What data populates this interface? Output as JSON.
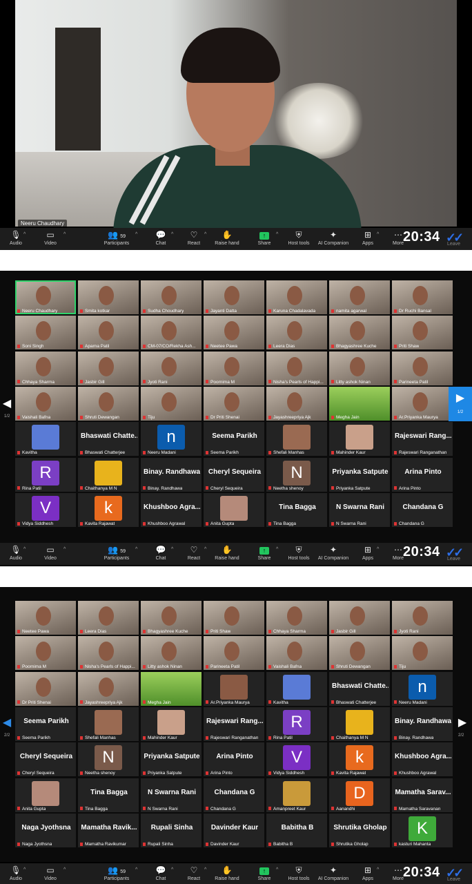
{
  "speaker": {
    "name": "Neeru Chaudhary"
  },
  "toolbar": {
    "audio": "Audio",
    "video": "Video",
    "participants": "Participants",
    "participants_count": "59",
    "chat": "Chat",
    "react": "React",
    "raise_hand": "Raise hand",
    "share": "Share",
    "host_tools": "Host tools",
    "ai_companion": "AI Companion",
    "apps": "Apps",
    "more": "More",
    "leave": "Leave",
    "clock": "20:34"
  },
  "page1": {
    "page_indicator_left": "1/2",
    "page_indicator_right": "1/2",
    "tiles": [
      {
        "name": "Neeru Chaudhary",
        "type": "cam",
        "active": true
      },
      {
        "name": "Smita kotkar",
        "type": "cam"
      },
      {
        "name": "Sudha Choudhary",
        "type": "cam"
      },
      {
        "name": "Jayanti Datta",
        "type": "cam"
      },
      {
        "name": "Karuna Chadalavada",
        "type": "cam"
      },
      {
        "name": "namita agarwal",
        "type": "cam"
      },
      {
        "name": "Dr Ruchi Bansal",
        "type": "cam"
      },
      {
        "name": "Soni Singh",
        "type": "cam"
      },
      {
        "name": "Aparna Patil",
        "type": "cam"
      },
      {
        "name": "CM-07/CO/Rekha Ash...",
        "type": "cam"
      },
      {
        "name": "Neetee Pawa",
        "type": "cam"
      },
      {
        "name": "Leera Dias",
        "type": "cam"
      },
      {
        "name": "Bhagyashree Kuche",
        "type": "cam"
      },
      {
        "name": "Priti Shaw",
        "type": "cam"
      },
      {
        "name": "Chhaya Sharma",
        "type": "cam"
      },
      {
        "name": "Jasbir Gill",
        "type": "cam"
      },
      {
        "name": "Jyoti Rani",
        "type": "cam"
      },
      {
        "name": "Poornima M",
        "type": "cam"
      },
      {
        "name": "Nisha's Pearls of Happi...",
        "type": "cam"
      },
      {
        "name": "Litty ashok Ninan",
        "type": "cam"
      },
      {
        "name": "Parineeta Patil",
        "type": "cam"
      },
      {
        "name": "Vaishali Bafna",
        "type": "cam"
      },
      {
        "name": "Shruti Dewangan",
        "type": "cam"
      },
      {
        "name": "Tiju",
        "type": "cam"
      },
      {
        "name": "Dr Priti Shenai",
        "type": "cam"
      },
      {
        "name": "Jayashreepriya Ajk",
        "type": "cam"
      },
      {
        "name": "Megha Jain",
        "type": "grass"
      },
      {
        "name": "Ar.Priyanka Maurya",
        "type": "cam"
      },
      {
        "name": "Kavitha",
        "type": "photo",
        "color": "#5a7bd6"
      },
      {
        "name": "Bhaswati Chatterjee",
        "type": "text",
        "big": "Bhaswati Chatte..."
      },
      {
        "name": "Neeru Madani",
        "type": "avatar",
        "letter": "n",
        "color": "#0b5cad"
      },
      {
        "name": "Seema Parikh",
        "type": "text",
        "big": "Seema Parikh"
      },
      {
        "name": "Shefali Manhas",
        "type": "photo",
        "color": "#9a6a52"
      },
      {
        "name": "Mahinder Kaur",
        "type": "photo",
        "color": "#c9a08a"
      },
      {
        "name": "Rajeswari Ranganathan",
        "type": "text",
        "big": "Rajeswari Rang..."
      },
      {
        "name": "Rina Patil",
        "type": "avatar",
        "letter": "R",
        "color": "#7b3fc4"
      },
      {
        "name": "Chaithanya M N",
        "type": "photo",
        "color": "#e8b31c"
      },
      {
        "name": "Binay. Randhawa",
        "type": "text",
        "big": "Binay. Randhawa"
      },
      {
        "name": "Cheryl Sequeira",
        "type": "text",
        "big": "Cheryl Sequeira"
      },
      {
        "name": "Neetha shenoy",
        "type": "avatar",
        "letter": "N",
        "color": "#7a5a4a"
      },
      {
        "name": "Priyanka Satpute",
        "type": "text",
        "big": "Priyanka Satpute"
      },
      {
        "name": "Arina Pinto",
        "type": "text",
        "big": "Arina Pinto"
      },
      {
        "name": "Vidya Siddhesh",
        "type": "avatar",
        "letter": "V",
        "color": "#7b2fc4"
      },
      {
        "name": "Kavita Rajawat",
        "type": "avatar",
        "letter": "k",
        "color": "#e86a1e"
      },
      {
        "name": "Khushboo Agrawal",
        "type": "text",
        "big": "Khushboo Agra..."
      },
      {
        "name": "Anita Gupta",
        "type": "photo",
        "color": "#b58a7a"
      },
      {
        "name": "Tina Bagga",
        "type": "text",
        "big": "Tina Bagga"
      },
      {
        "name": "N Swarna Rani",
        "type": "text",
        "big": "N Swarna Rani"
      },
      {
        "name": "Chandana G",
        "type": "text",
        "big": "Chandana G"
      }
    ]
  },
  "page2": {
    "page_indicator_left": "2/2",
    "page_indicator_right": "2/2",
    "tiles": [
      {
        "name": "Neetee Pawa",
        "type": "cam"
      },
      {
        "name": "Leera Dias",
        "type": "cam"
      },
      {
        "name": "Bhagyashree Kuche",
        "type": "cam"
      },
      {
        "name": "Priti Shaw",
        "type": "cam"
      },
      {
        "name": "Chhaya Sharma",
        "type": "cam"
      },
      {
        "name": "Jasbir Gill",
        "type": "cam"
      },
      {
        "name": "Jyoti Rani",
        "type": "cam"
      },
      {
        "name": "Poornima M",
        "type": "cam"
      },
      {
        "name": "Nisha's Pearls of Happi...",
        "type": "cam"
      },
      {
        "name": "Litty ashok Ninan",
        "type": "cam"
      },
      {
        "name": "Parineeta Patil",
        "type": "cam"
      },
      {
        "name": "Vaishali Bafna",
        "type": "cam"
      },
      {
        "name": "Shruti Dewangan",
        "type": "cam"
      },
      {
        "name": "Tiju",
        "type": "cam"
      },
      {
        "name": "Dr Priti Shenai",
        "type": "cam"
      },
      {
        "name": "Jayashreepriya Ajk",
        "type": "cam"
      },
      {
        "name": "Megha Jain",
        "type": "grass"
      },
      {
        "name": "Ar.Priyanka Maurya",
        "type": "photo",
        "color": "#8a5a44"
      },
      {
        "name": "Kavitha",
        "type": "photo",
        "color": "#5a7bd6"
      },
      {
        "name": "Bhaswati Chatterjee",
        "type": "text",
        "big": "Bhaswati Chatte..."
      },
      {
        "name": "Neeru Madani",
        "type": "avatar",
        "letter": "n",
        "color": "#0b5cad"
      },
      {
        "name": "Seema Parikh",
        "type": "text",
        "big": "Seema Parikh"
      },
      {
        "name": "Shefali Manhas",
        "type": "photo",
        "color": "#9a6a52"
      },
      {
        "name": "Mahinder Kaur",
        "type": "photo",
        "color": "#c9a08a"
      },
      {
        "name": "Rajeswari Ranganathan",
        "type": "text",
        "big": "Rajeswari Rang..."
      },
      {
        "name": "Rina Patil",
        "type": "avatar",
        "letter": "R",
        "color": "#7b3fc4"
      },
      {
        "name": "Chaithanya M N",
        "type": "photo",
        "color": "#e8b31c"
      },
      {
        "name": "Binay. Randhawa",
        "type": "text",
        "big": "Binay. Randhawa"
      },
      {
        "name": "Cheryl Sequeira",
        "type": "text",
        "big": "Cheryl Sequeira"
      },
      {
        "name": "Neetha shenoy",
        "type": "avatar",
        "letter": "N",
        "color": "#7a5a4a"
      },
      {
        "name": "Priyanka Satpute",
        "type": "text",
        "big": "Priyanka Satpute"
      },
      {
        "name": "Arina Pinto",
        "type": "text",
        "big": "Arina Pinto"
      },
      {
        "name": "Vidya Siddhesh",
        "type": "avatar",
        "letter": "V",
        "color": "#7b2fc4"
      },
      {
        "name": "Kavita Rajawat",
        "type": "avatar",
        "letter": "k",
        "color": "#e86a1e"
      },
      {
        "name": "Khushboo Agrawal",
        "type": "text",
        "big": "Khushboo Agra..."
      },
      {
        "name": "Anita Gupta",
        "type": "photo",
        "color": "#b58a7a"
      },
      {
        "name": "Tina Bagga",
        "type": "text",
        "big": "Tina Bagga"
      },
      {
        "name": "N Swarna Rani",
        "type": "text",
        "big": "N Swarna Rani"
      },
      {
        "name": "Chandana G",
        "type": "text",
        "big": "Chandana G"
      },
      {
        "name": "Amanpreet Kaur",
        "type": "photo",
        "color": "#c99a3a"
      },
      {
        "name": "Aanandhi",
        "type": "avatar",
        "letter": "D",
        "color": "#e8641e"
      },
      {
        "name": "Mamatha Saravanan",
        "type": "text",
        "big": "Mamatha Sarav..."
      },
      {
        "name": "Naga Jyothsna",
        "type": "text",
        "big": "Naga Jyothsna"
      },
      {
        "name": "Mamatha Ravikumar",
        "type": "text",
        "big": "Mamatha Ravik..."
      },
      {
        "name": "Rupali Sinha",
        "type": "text",
        "big": "Rupali Sinha"
      },
      {
        "name": "Davinder Kaur",
        "type": "text",
        "big": "Davinder Kaur"
      },
      {
        "name": "Babitha B",
        "type": "text",
        "big": "Babitha B"
      },
      {
        "name": "Shrutika Gholap",
        "type": "text",
        "big": "Shrutika Gholap"
      },
      {
        "name": "kasturi Mahanta",
        "type": "avatar",
        "letter": "K",
        "color": "#3faa3a"
      }
    ]
  }
}
